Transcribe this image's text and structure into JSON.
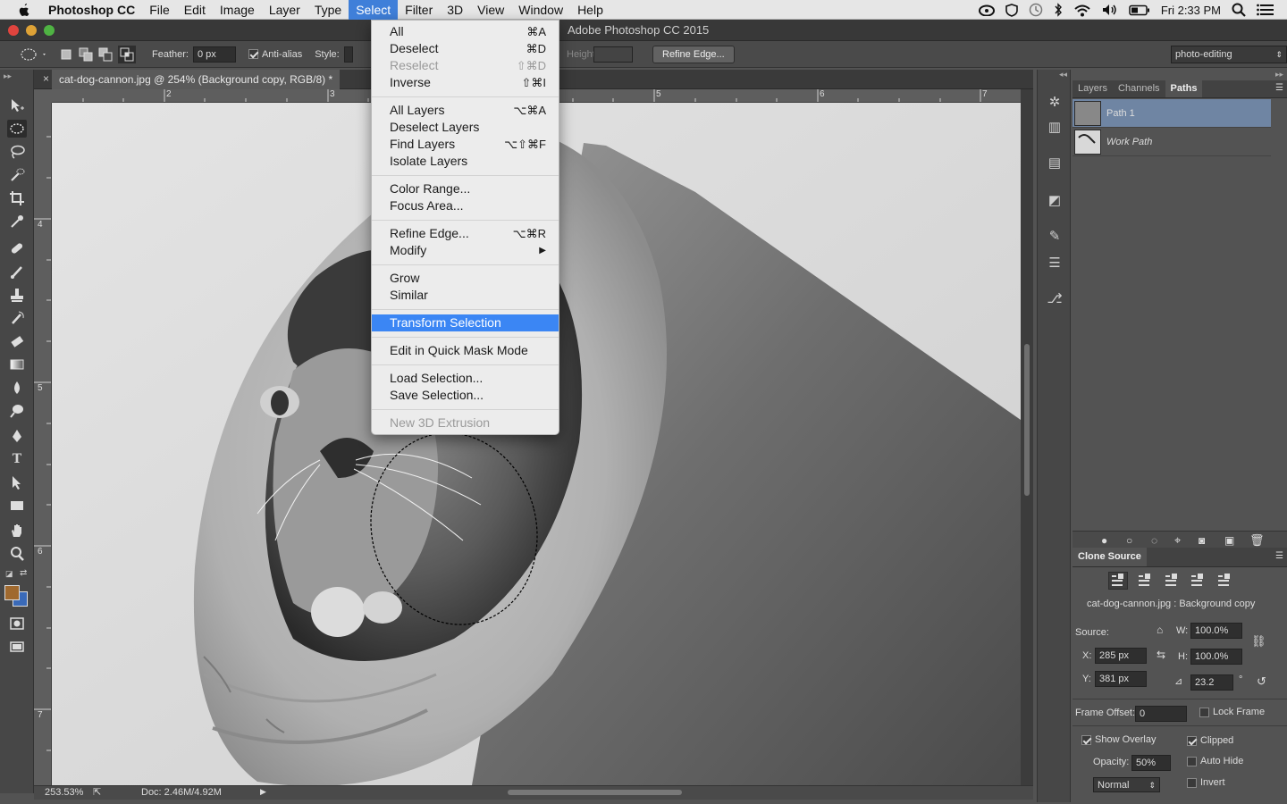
{
  "menubar": {
    "app": "Photoshop CC",
    "items": [
      "File",
      "Edit",
      "Image",
      "Layer",
      "Type",
      "Select",
      "Filter",
      "3D",
      "View",
      "Window",
      "Help"
    ],
    "active": "Select",
    "clock": "Fri 2:33 PM"
  },
  "window": {
    "title": "Adobe Photoshop CC 2015"
  },
  "options": {
    "feather_label": "Feather:",
    "feather_value": "0 px",
    "antialias_label": "Anti-alias",
    "style_label": "Style:",
    "height_label": "Height:",
    "refine_edge": "Refine Edge...",
    "workspace": "photo-editing"
  },
  "document": {
    "tab": "cat-dog-cannon.jpg @ 254% (Background copy, RGB/8) *",
    "zoom": "253.53%",
    "doc_size": "Doc: 2.46M/4.92M",
    "ruler_top": [
      "2",
      "3",
      "5",
      "6",
      "7"
    ],
    "ruler_left": [
      "4",
      "5",
      "6",
      "7"
    ]
  },
  "select_menu": {
    "items": [
      {
        "label": "All",
        "shortcut": "⌘A"
      },
      {
        "label": "Deselect",
        "shortcut": "⌘D"
      },
      {
        "label": "Reselect",
        "shortcut": "⇧⌘D"
      },
      {
        "label": "Inverse",
        "shortcut": "⇧⌘I"
      },
      {
        "label": "All Layers",
        "shortcut": "⌥⌘A"
      },
      {
        "label": "Deselect Layers",
        "shortcut": ""
      },
      {
        "label": "Find Layers",
        "shortcut": "⌥⇧⌘F"
      },
      {
        "label": "Isolate Layers",
        "shortcut": ""
      },
      {
        "label": "Color Range...",
        "shortcut": ""
      },
      {
        "label": "Focus Area...",
        "shortcut": ""
      },
      {
        "label": "Refine Edge...",
        "shortcut": "⌥⌘R"
      },
      {
        "label": "Modify",
        "shortcut": "▶"
      },
      {
        "label": "Grow",
        "shortcut": ""
      },
      {
        "label": "Similar",
        "shortcut": ""
      },
      {
        "label": "Transform Selection",
        "shortcut": ""
      },
      {
        "label": "Edit in Quick Mask Mode",
        "shortcut": ""
      },
      {
        "label": "Load Selection...",
        "shortcut": ""
      },
      {
        "label": "Save Selection...",
        "shortcut": ""
      },
      {
        "label": "New 3D Extrusion",
        "shortcut": ""
      }
    ]
  },
  "paths_panel": {
    "tabs": [
      "Layers",
      "Channels",
      "Paths"
    ],
    "active_tab": "Paths",
    "paths": [
      "Path 1",
      "Work Path"
    ]
  },
  "clone_source": {
    "title": "Clone Source",
    "source_name": "cat-dog-cannon.jpg : Background copy",
    "source_label": "Source:",
    "w_label": "W:",
    "w": "100.0%",
    "h_label": "H:",
    "h": "100.0%",
    "x_label": "X:",
    "x": "285 px",
    "y_label": "Y:",
    "y": "381 px",
    "angle": "23.2",
    "degree": "°",
    "frame_offset_label": "Frame Offset:",
    "frame_offset": "0",
    "lock_frame": "Lock Frame",
    "show_overlay": "Show Overlay",
    "clipped": "Clipped",
    "opacity_label": "Opacity:",
    "opacity": "50%",
    "auto_hide": "Auto Hide",
    "invert": "Invert",
    "blend_mode": "Normal"
  },
  "colors": {
    "foreground": "#a0692e",
    "background": "#3a6ab8",
    "highlight": "#3b86f4"
  }
}
